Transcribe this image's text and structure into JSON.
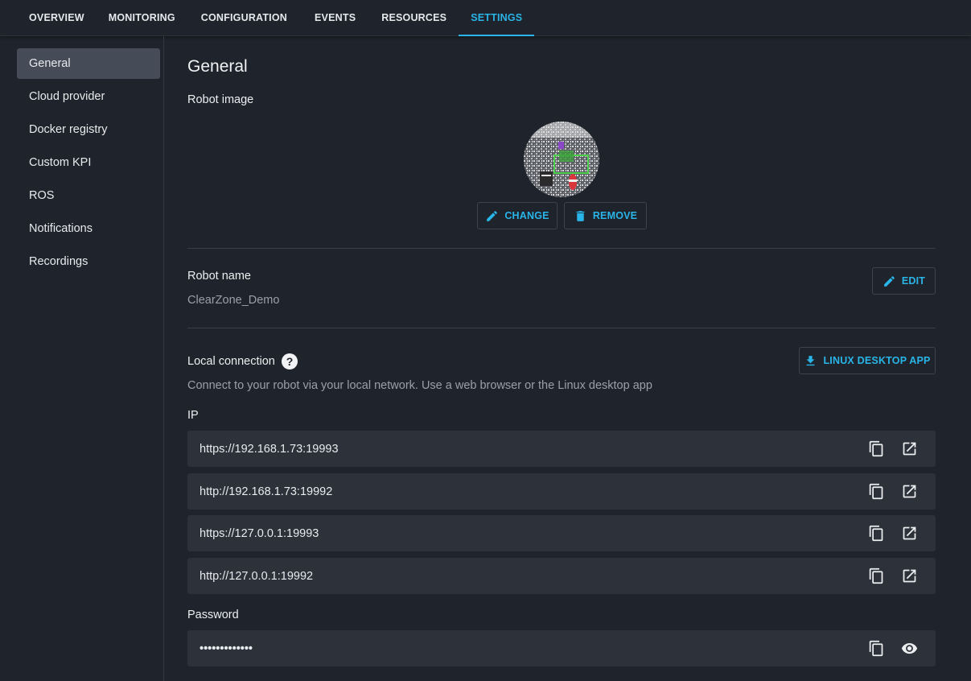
{
  "nav": {
    "tabs": [
      "OVERVIEW",
      "MONITORING",
      "CONFIGURATION",
      "EVENTS",
      "RESOURCES",
      "SETTINGS"
    ],
    "active": "SETTINGS"
  },
  "sidebar": {
    "items": [
      "General",
      "Cloud provider",
      "Docker registry",
      "Custom KPI",
      "ROS",
      "Notifications",
      "Recordings"
    ],
    "active": "General"
  },
  "general": {
    "title": "General",
    "robot_image_label": "Robot image",
    "change_label": "CHANGE",
    "remove_label": "REMOVE",
    "robot_name_label": "Robot name",
    "robot_name_value": "ClearZone_Demo",
    "edit_label": "EDIT",
    "local_connection_label": "Local connection",
    "help_glyph": "?",
    "linux_app_label": "LINUX DESKTOP APP",
    "local_connection_desc": "Connect to your robot via your local network. Use a web browser or the Linux desktop app",
    "ip_label": "IP",
    "ips": [
      "https://192.168.1.73:19993",
      "http://192.168.1.73:19992",
      "https://127.0.0.1:19993",
      "http://127.0.0.1:19992"
    ],
    "password_label": "Password",
    "password_value": "•••••••••••••"
  },
  "colors": {
    "accent": "#29b5e8",
    "background": "#1f232b",
    "field": "#2d313a",
    "sidebar_active": "#454c57"
  },
  "icons": [
    "pencil-icon",
    "trash-icon",
    "download-icon",
    "help-icon",
    "copy-icon",
    "open-external-icon",
    "eye-icon"
  ]
}
